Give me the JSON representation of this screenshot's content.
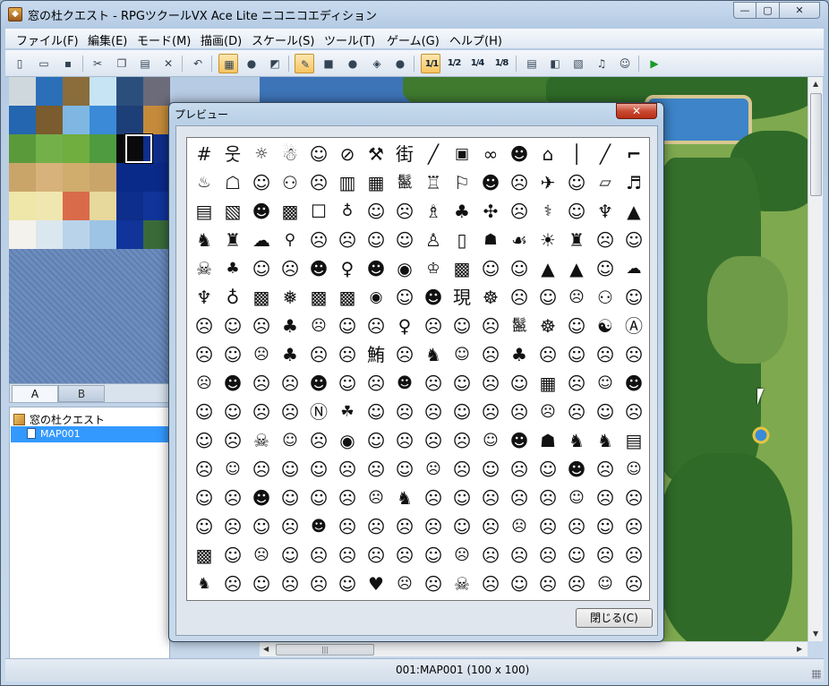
{
  "window": {
    "title": "窓の杜クエスト - RPGツクールVX Ace Lite ニコニコエディション",
    "controls": {
      "minimize": "—",
      "maximize": "▢",
      "close": "✕"
    }
  },
  "menubar": {
    "items": [
      {
        "label": "ファイル(F)"
      },
      {
        "label": "編集(E)"
      },
      {
        "label": "モード(M)"
      },
      {
        "label": "描画(D)"
      },
      {
        "label": "スケール(S)"
      },
      {
        "label": "ツール(T)"
      },
      {
        "label": "ゲーム(G)"
      },
      {
        "label": "ヘルプ(H)"
      }
    ]
  },
  "toolbar": {
    "buttons": [
      {
        "icon": "new-icon",
        "glyph": "▯"
      },
      {
        "icon": "open-icon",
        "glyph": "▭"
      },
      {
        "icon": "save-icon",
        "glyph": "▪"
      },
      {
        "icon": "cut-icon",
        "glyph": "✂"
      },
      {
        "icon": "copy-icon",
        "glyph": "❐"
      },
      {
        "icon": "paste-icon",
        "glyph": "▤"
      },
      {
        "icon": "delete-icon",
        "glyph": "✕"
      },
      {
        "icon": "undo-icon",
        "glyph": "↶"
      },
      {
        "icon": "map-layer-icon",
        "glyph": "▦",
        "active": true
      },
      {
        "icon": "event-layer-icon",
        "glyph": "●"
      },
      {
        "icon": "region-layer-icon",
        "glyph": "◩"
      },
      {
        "icon": "pencil-icon",
        "glyph": "✎",
        "active": true
      },
      {
        "icon": "rectangle-icon",
        "glyph": "■"
      },
      {
        "icon": "ellipse-icon",
        "glyph": "●"
      },
      {
        "icon": "fill-icon",
        "glyph": "◈"
      },
      {
        "icon": "shadow-pen-icon",
        "glyph": "●"
      },
      {
        "icon": "scale-1-1-icon",
        "glyph": "1/1",
        "active": true
      },
      {
        "icon": "scale-1-2-icon",
        "glyph": "1/2"
      },
      {
        "icon": "scale-1-4-icon",
        "glyph": "1/4"
      },
      {
        "icon": "scale-1-8-icon",
        "glyph": "1/8"
      },
      {
        "icon": "database-icon",
        "glyph": "▤"
      },
      {
        "icon": "resource-manager-icon",
        "glyph": "◧"
      },
      {
        "icon": "script-editor-icon",
        "glyph": "▧"
      },
      {
        "icon": "sound-test-icon",
        "glyph": "♫"
      },
      {
        "icon": "character-generator-icon",
        "glyph": "☺"
      },
      {
        "icon": "playtest-icon",
        "glyph": "▶"
      }
    ]
  },
  "tileset": {
    "tabs": [
      {
        "label": "A"
      },
      {
        "label": "B"
      }
    ]
  },
  "map_tree": {
    "root": "窓の杜クエスト",
    "maps": [
      "MAP001"
    ]
  },
  "status": {
    "text": "001:MAP001 (100 x 100)"
  },
  "dialog": {
    "title": "プレビュー",
    "close_glyph": "✕",
    "close_button": "閉じる(C)",
    "glyphs": [
      "#",
      "웃",
      "☼",
      "☃",
      "☺",
      "⊘",
      "⚒",
      "街",
      "╱",
      "▣",
      "∞",
      "☻",
      "⌂",
      "│",
      "╱",
      "⌐",
      "♨",
      "☖",
      "☺",
      "⚇",
      "☹",
      "▥",
      "▦",
      "鬣",
      "♖",
      "⚐",
      "☻",
      "☹",
      "✈",
      "☺",
      "▱",
      "♬",
      "▤",
      "▧",
      "☻",
      "▩",
      "☐",
      "♁",
      "☺",
      "☹",
      "♗",
      "♣",
      "✣",
      "☹",
      "⚕",
      "☺",
      "♆",
      "▲",
      "♞",
      "♜",
      "☁",
      "⚲",
      "☹",
      "☹",
      "☺",
      "☺",
      "♙",
      "▯",
      "☗",
      "☙",
      "☀",
      "♜",
      "☹",
      "☺",
      "☠",
      "♣",
      "☺",
      "☹",
      "☻",
      "♀",
      "☻",
      "◉",
      "♔",
      "▩",
      "☺",
      "☺",
      "▲",
      "▲",
      "☺",
      "☁",
      "♆",
      "♁",
      "▩",
      "❅",
      "▩",
      "▩",
      "◉",
      "☺",
      "☻",
      "現",
      "☸",
      "☹",
      "☺",
      "☹",
      "⚇",
      "☺",
      "☹",
      "☺",
      "☹",
      "♣",
      "☹",
      "☺",
      "☹",
      "♀",
      "☹",
      "☺",
      "☹",
      "鬣",
      "☸",
      "☺",
      "☯",
      "Ⓐ",
      "☹",
      "☺",
      "☹",
      "♣",
      "☹",
      "☹",
      "鮪",
      "☹",
      "♞",
      "☺",
      "☹",
      "♣",
      "☹",
      "☺",
      "☹",
      "☹",
      "☹",
      "☻",
      "☹",
      "☹",
      "☻",
      "☺",
      "☹",
      "☻",
      "☹",
      "☺",
      "☹",
      "☺",
      "▦",
      "☹",
      "☺",
      "☻",
      "☺",
      "☺",
      "☹",
      "☹",
      "Ⓝ",
      "☘",
      "☺",
      "☹",
      "☹",
      "☺",
      "☹",
      "☹",
      "☹",
      "☹",
      "☺",
      "☹",
      "☺",
      "☹",
      "☠",
      "☺",
      "☹",
      "◉",
      "☺",
      "☹",
      "☹",
      "☹",
      "☺",
      "☻",
      "☗",
      "♞",
      "♞",
      "▤",
      "☹",
      "☺",
      "☹",
      "☺",
      "☺",
      "☹",
      "☹",
      "☺",
      "☹",
      "☹",
      "☺",
      "☹",
      "☺",
      "☻",
      "☹",
      "☺",
      "☺",
      "☹",
      "☻",
      "☺",
      "☺",
      "☹",
      "☹",
      "♞",
      "☹",
      "☺",
      "☹",
      "☹",
      "☹",
      "☺",
      "☹",
      "☹",
      "☺",
      "☹",
      "☺",
      "☹",
      "☻",
      "☹",
      "☹",
      "☹",
      "☹",
      "☺",
      "☹",
      "☹",
      "☹",
      "☹",
      "☺",
      "☹",
      "▩",
      "☺",
      "☹",
      "☺",
      "☹",
      "☹",
      "☹",
      "☹",
      "☺",
      "☹",
      "☹",
      "☹",
      "☹",
      "☺",
      "☹",
      "☹",
      "♞",
      "☹",
      "☺",
      "☹",
      "☹",
      "☺",
      "♥",
      "☹",
      "☹",
      "☠",
      "☹",
      "☺",
      "☹",
      "☹",
      "☺",
      "☹"
    ]
  },
  "colors": {
    "tiles": [
      "#cfd8dc",
      "#2a6fb8",
      "#8a6d3b",
      "#c7e4f4",
      "#2b4f7d",
      "#6b6b7a",
      "#2466b0",
      "#7a5c2e",
      "#7fb7e3",
      "#3a8ad8",
      "#1d3f78",
      "#c58b3a",
      "#5a9a3a",
      "#74b04a",
      "#6fae3f",
      "#4f9b3f",
      "#0a0a0a",
      "#0d2e8a",
      "#c9a56a",
      "#d7b27a",
      "#d0ad6c",
      "#c9a56a",
      "#0a2a8a",
      "#0a2a8a",
      "#efe6a9",
      "#f0e7b0",
      "#d96b4a",
      "#e7d89c",
      "#0d2e8a",
      "#10349a",
      "#f4f2ec",
      "#dbe7ef",
      "#b9d4ea",
      "#9dc4e4",
      "#10349a",
      "#3a6a3a"
    ]
  }
}
